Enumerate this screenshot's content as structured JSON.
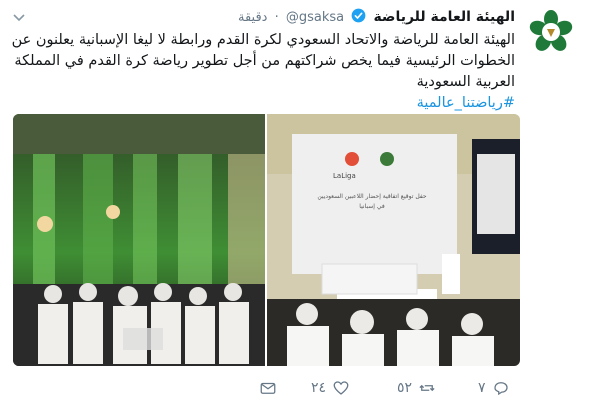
{
  "tweet": {
    "display_name": "الهيئة العامة للرياضة",
    "handle": "@gsaksa",
    "time": "دقيقة",
    "text_lines": [
      "الهيئة العامة للرياضة والاتحاد السعودي لكرة القدم ورابطة لا ليغا الإسبانية يعلنون عن",
      "الخطوات الرئيسية فيما يخص شراكتهم من أجل تطوير رياضة كرة القدم في المملكة",
      "العربية السعودية"
    ],
    "hashtag": "#رياضتنا_عالمية"
  },
  "media": {
    "left_alt": "قاعة مؤتمر بإضاءة خضراء",
    "right_alt": "منصة المؤتمر مع شعار لا ليغا",
    "screen_logo": "LaLiga",
    "screen_caption_line1": "حفل توقيع اتفاقية إحضار اللاعبين السعوديين",
    "screen_caption_line2": "في إسبانيا"
  },
  "actions": {
    "reply_count": "٧",
    "retweet_count": "٥٢",
    "like_count": "٢٤"
  },
  "colors": {
    "link": "#1b95e0",
    "muted": "#657786",
    "verified": "#1da1f2"
  }
}
